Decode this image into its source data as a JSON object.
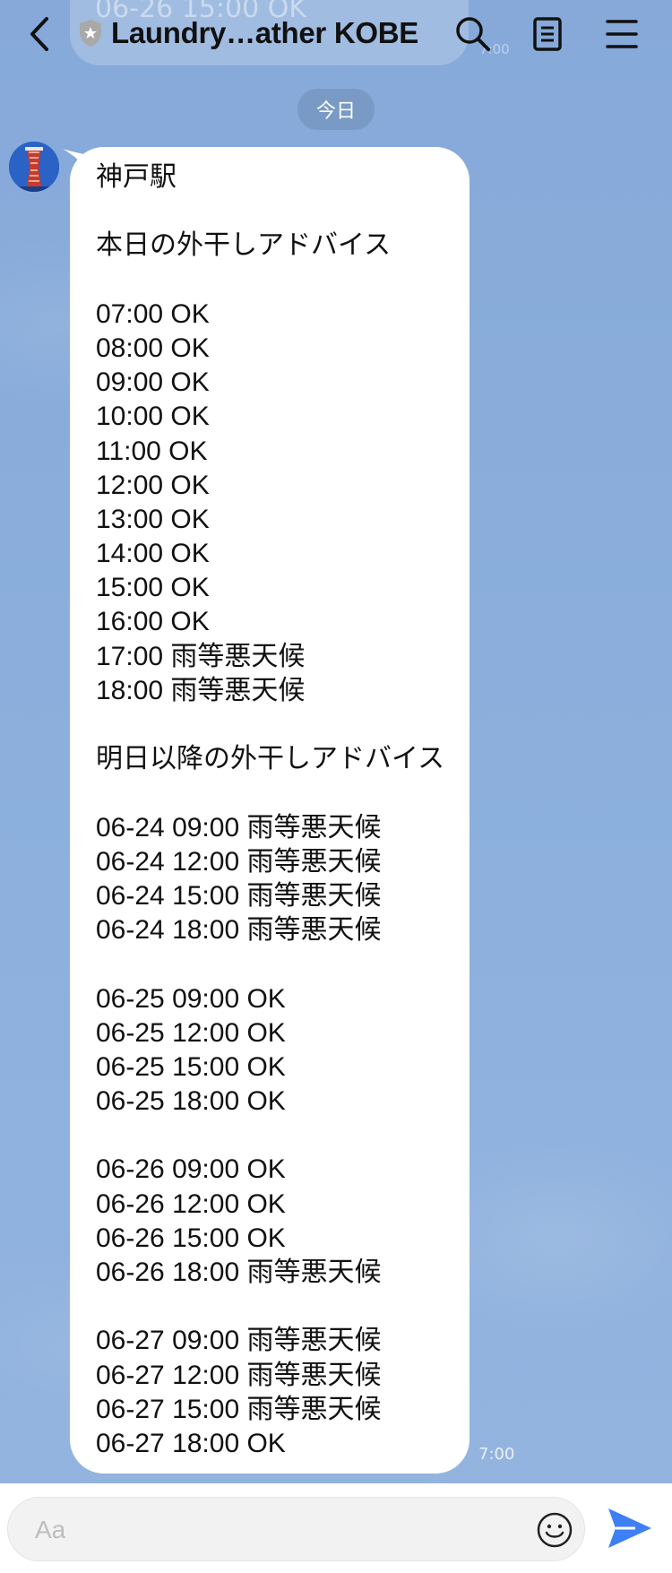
{
  "header": {
    "title": "Laundry…ather KOBE",
    "previous_message_peek": "06-26 15:00 OK",
    "previous_time_peek": "7:00"
  },
  "date_divider": "今日",
  "message": {
    "sender_avatar": "kobe-port-tower-avatar",
    "lines": [
      "神戸駅",
      "",
      "本日の外干しアドバイス",
      "",
      "07:00 OK",
      "08:00 OK",
      "09:00 OK",
      "10:00 OK",
      "11:00 OK",
      "12:00 OK",
      "13:00 OK",
      "14:00 OK",
      "15:00 OK",
      "16:00 OK",
      "17:00 雨等悪天候",
      "18:00 雨等悪天候",
      "",
      "明日以降の外干しアドバイス",
      "",
      "06-24 09:00 雨等悪天候",
      "06-24 12:00 雨等悪天候",
      "06-24 15:00 雨等悪天候",
      "06-24 18:00 雨等悪天候",
      "",
      "06-25 09:00 OK",
      "06-25 12:00 OK",
      "06-25 15:00 OK",
      "06-25 18:00 OK",
      "",
      "06-26 09:00 OK",
      "06-26 12:00 OK",
      "06-26 15:00 OK",
      "06-26 18:00 雨等悪天候",
      "",
      "06-27 09:00 雨等悪天候",
      "06-27 12:00 雨等悪天候",
      "06-27 15:00 雨等悪天候",
      "06-27 18:00 OK"
    ],
    "time": "7:00"
  },
  "composer": {
    "placeholder": "Aa",
    "value": ""
  },
  "colors": {
    "background": "#8aaedc",
    "bubble": "#ffffff",
    "send_accent": "#3d7ff5"
  },
  "icons": [
    "back-arrow-icon",
    "shield-icon",
    "search-icon",
    "notes-icon",
    "menu-icon",
    "emoji-icon",
    "send-icon"
  ]
}
